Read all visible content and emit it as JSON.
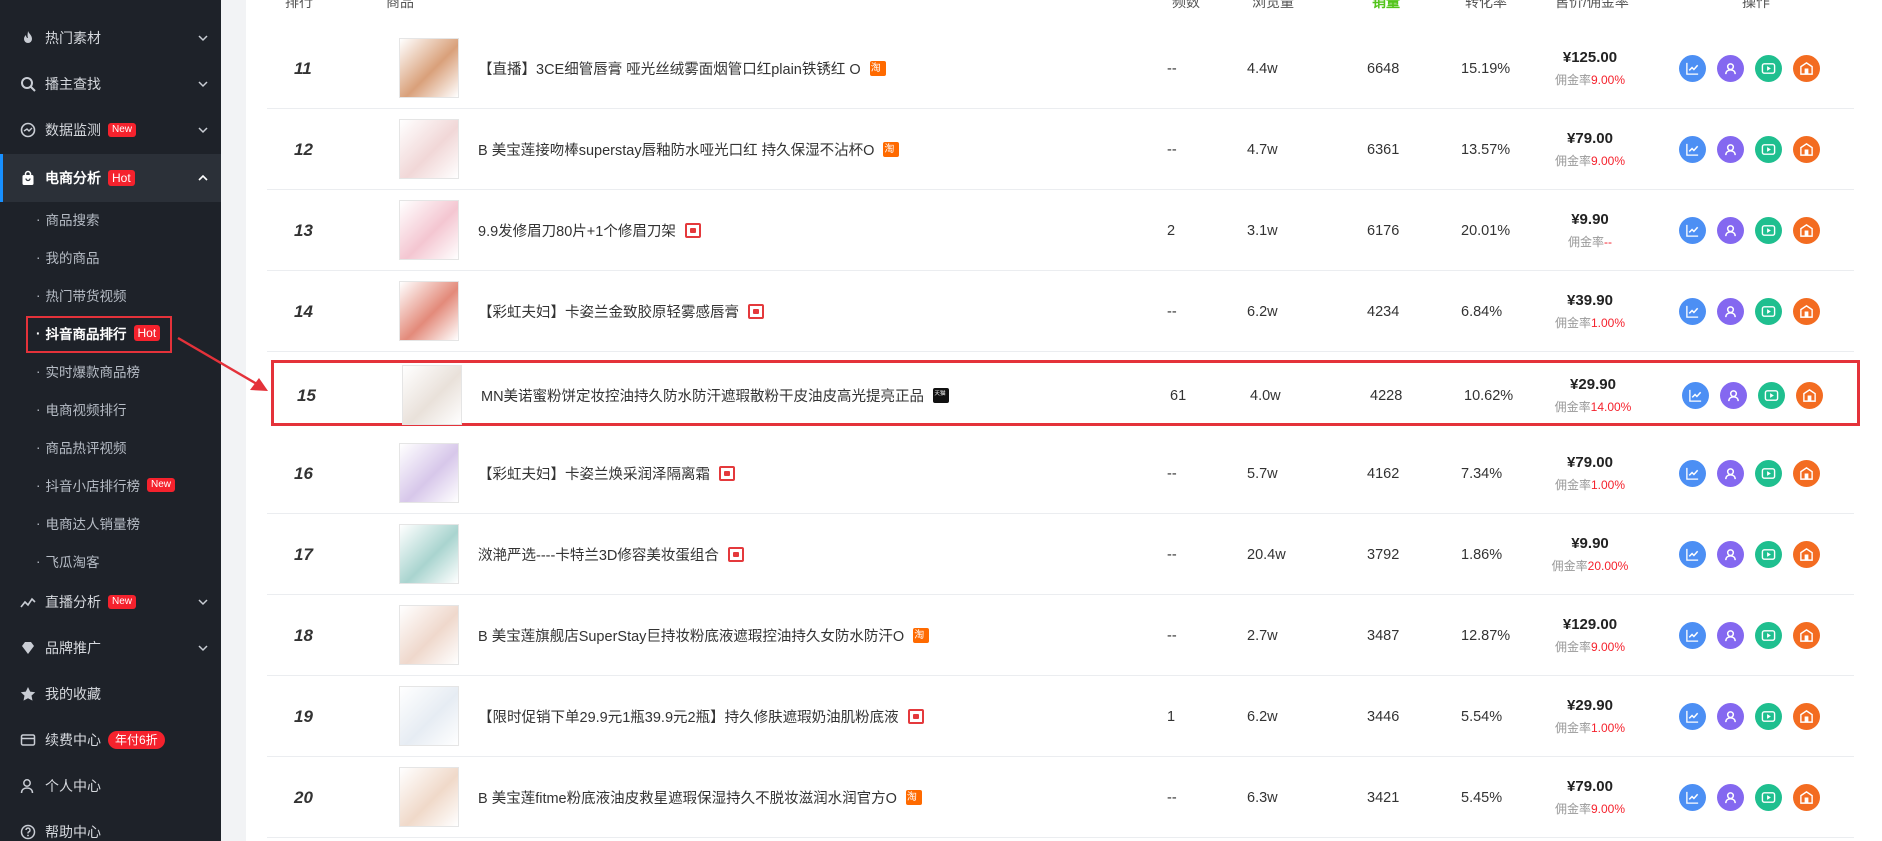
{
  "colors": {
    "accent_red": "#f5222d",
    "sidebar_bg": "#1e2229",
    "sales_header_green": "#52c41a",
    "annotation_red": "#e4323a"
  },
  "sidebar": {
    "top_items": [
      {
        "label": "热门素材",
        "icon": "fire-icon"
      },
      {
        "label": "播主查找",
        "icon": "search-icon"
      },
      {
        "label": "数据监测",
        "icon": "dashboard-icon",
        "badge": "New"
      }
    ],
    "active_item": {
      "label": "电商分析",
      "icon": "shopping-bag-icon",
      "badge": "Hot"
    },
    "sub_items": [
      {
        "label": "商品搜索"
      },
      {
        "label": "我的商品"
      },
      {
        "label": "热门带货视频"
      },
      {
        "label": "抖音商品排行",
        "badge": "Hot"
      },
      {
        "label": "实时爆款商品榜"
      },
      {
        "label": "电商视频排行"
      },
      {
        "label": "商品热评视频"
      },
      {
        "label": "抖音小店排行榜",
        "badge": "New"
      },
      {
        "label": "电商达人销量榜"
      },
      {
        "label": "飞瓜淘客"
      }
    ],
    "bottom_items": [
      {
        "label": "直播分析",
        "icon": "live-trend-icon",
        "badge": "New"
      },
      {
        "label": "品牌推广",
        "icon": "diamond-icon"
      },
      {
        "label": "我的收藏",
        "icon": "star-icon"
      },
      {
        "label": "续费中心",
        "icon": "wallet-icon",
        "badge": "年付6折"
      },
      {
        "label": "个人中心",
        "icon": "user-icon"
      },
      {
        "label": "帮助中心",
        "icon": "help-icon"
      }
    ]
  },
  "table": {
    "headers": {
      "rank": "排行",
      "product": "商品",
      "frequency": "频数",
      "views": "浏览量",
      "sales": "销量",
      "conversion": "转化率",
      "price_commission": "售价/佣金率",
      "actions": "操作"
    },
    "commission_label": "佣金率",
    "rows": [
      {
        "rank": "11",
        "title": "【直播】3CE细管唇膏 哑光丝绒雾面烟管口红plain铁锈红 O",
        "store": "tb",
        "freq": "--",
        "views": "4.4w",
        "sales": "6648",
        "conv": "15.19%",
        "price": "¥125.00",
        "commission": "9.00%",
        "thumb": "#d9a07a"
      },
      {
        "rank": "12",
        "title": "B 美宝莲接吻棒superstay唇釉防水哑光口红 持久保湿不沾杯O",
        "store": "tb",
        "freq": "--",
        "views": "4.7w",
        "sales": "6361",
        "conv": "13.57%",
        "price": "¥79.00",
        "commission": "9.00%",
        "thumb": "#f1d7d7"
      },
      {
        "rank": "13",
        "title": "9.9发修眉刀80片+1个修眉刀架",
        "store": "dy",
        "freq": "2",
        "views": "3.1w",
        "sales": "6176",
        "conv": "20.01%",
        "price": "¥9.90",
        "commission": "--",
        "thumb": "#f4c6d1"
      },
      {
        "rank": "14",
        "title": "【彩虹夫妇】卡姿兰金致胶原轻雾感唇膏",
        "store": "dy",
        "freq": "--",
        "views": "6.2w",
        "sales": "4234",
        "conv": "6.84%",
        "price": "¥39.90",
        "commission": "1.00%",
        "thumb": "#e38a7a"
      },
      {
        "rank": "15",
        "title": "MN美诺蜜粉饼定妆控油持久防水防汗遮瑕散粉干皮油皮高光提亮正品",
        "store": "tm",
        "freq": "61",
        "views": "4.0w",
        "sales": "4228",
        "conv": "10.62%",
        "price": "¥29.90",
        "commission": "14.00%",
        "thumb": "#e9e1da"
      },
      {
        "rank": "16",
        "title": "【彩虹夫妇】卡姿兰焕采润泽隔离霜",
        "store": "dy",
        "freq": "--",
        "views": "5.7w",
        "sales": "4162",
        "conv": "7.34%",
        "price": "¥79.00",
        "commission": "1.00%",
        "thumb": "#d7c7ea"
      },
      {
        "rank": "17",
        "title": "滧滟严选----卡特兰3D修容美妆蛋组合",
        "store": "dy",
        "freq": "--",
        "views": "20.4w",
        "sales": "3792",
        "conv": "1.86%",
        "price": "¥9.90",
        "commission": "20.00%",
        "thumb": "#a9d4cf"
      },
      {
        "rank": "18",
        "title": "B 美宝莲旗舰店SuperStay巨持妆粉底液遮瑕控油持久女防水防汗O",
        "store": "tb",
        "freq": "--",
        "views": "2.7w",
        "sales": "3487",
        "conv": "12.87%",
        "price": "¥129.00",
        "commission": "9.00%",
        "thumb": "#efd8cc"
      },
      {
        "rank": "19",
        "title": "【限时促销下单29.9元1瓶39.9元2瓶】持久修肤遮瑕奶油肌粉底液",
        "store": "dy",
        "freq": "1",
        "views": "6.2w",
        "sales": "3446",
        "conv": "5.54%",
        "price": "¥29.90",
        "commission": "1.00%",
        "thumb": "#e6ecf3"
      },
      {
        "rank": "20",
        "title": "B 美宝莲fitme粉底液油皮救星遮瑕保湿持久不脱妆滋润水润官方O",
        "store": "tb",
        "freq": "--",
        "views": "6.3w",
        "sales": "3421",
        "conv": "5.45%",
        "price": "¥79.00",
        "commission": "9.00%",
        "thumb": "#f0d9c9"
      }
    ]
  },
  "action_icons": [
    "trend-chart-icon",
    "user-profile-icon",
    "play-video-icon",
    "store-icon"
  ]
}
